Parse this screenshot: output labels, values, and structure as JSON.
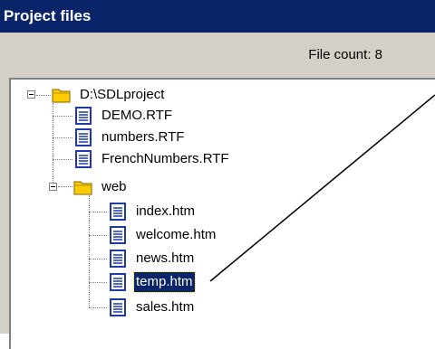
{
  "window": {
    "title": "Project files"
  },
  "status": {
    "file_count_label": "File count: 8"
  },
  "tree": {
    "root": {
      "label": "D:\\SDLproject",
      "files": [
        "DEMO.RTF",
        "numbers.RTF",
        "FrenchNumbers.RTF"
      ],
      "folder": {
        "label": "web",
        "files": [
          "index.htm",
          "welcome.htm",
          "news.htm",
          "temp.htm",
          "sales.htm"
        ]
      }
    },
    "selected": "temp.htm"
  },
  "icons": {
    "folder": "folder-icon",
    "file": "document-icon",
    "expander": "collapse-icon"
  },
  "colors": {
    "titlebar": "#0a246a",
    "panel": "#d4d0c8",
    "selection": "#0a246a",
    "folder": "#ffcc00",
    "doc": "#1f3aa8"
  }
}
